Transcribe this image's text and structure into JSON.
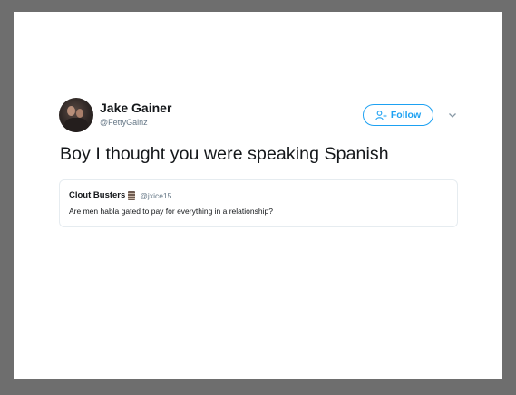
{
  "tweet": {
    "display_name": "Jake Gainer",
    "handle": "@FettyGainz",
    "follow_label": "Follow",
    "text": "Boy I thought you were speaking Spanish"
  },
  "quoted_tweet": {
    "display_name": "Clout Busters",
    "handle": "@jxice15",
    "text": "Are men habla gated to pay for everything in a relationship?"
  },
  "colors": {
    "frame": "#6e6e6e",
    "card": "#ffffff",
    "accent": "#1da1f2",
    "text": "#14171a",
    "muted": "#657786"
  },
  "icons": {
    "follow": "add-user-icon",
    "menu": "chevron-down-icon",
    "name_emoji": "building-icon"
  }
}
